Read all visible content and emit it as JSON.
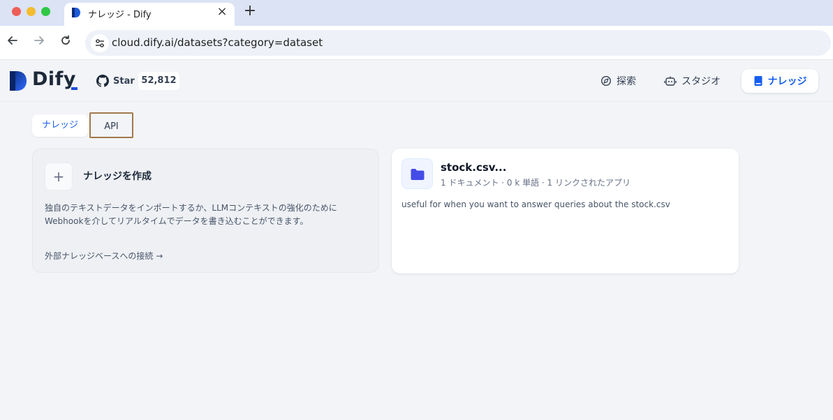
{
  "browser": {
    "tab_title": "ナレッジ - Dify",
    "close_glyph": "×",
    "new_tab_glyph": "+",
    "url": "cloud.dify.ai/datasets?category=dataset"
  },
  "header": {
    "logo_text": "Dify",
    "github_label": "Star",
    "github_stars": "52,812",
    "nav": {
      "explore": "探索",
      "studio": "スタジオ",
      "knowledge": "ナレッジ"
    }
  },
  "tabs": {
    "knowledge": "ナレッジ",
    "api": "API"
  },
  "create_card": {
    "title": "ナレッジを作成",
    "description": "独自のテキストデータをインポートするか、LLMコンテキストの強化のためにWebhookを介してリアルタイムでデータを書き込むことができます。",
    "external_link": "外部ナレッジベースへの接続 →"
  },
  "dataset": {
    "name": "stock.csv...",
    "meta": "1 ドキュメント · 0 k 単語 · 1 リンクされたアプリ",
    "description": "useful for when you want to answer queries about the stock.csv"
  },
  "colors": {
    "accent": "#155eef",
    "background": "#f2f4f7",
    "highlight_border": "#a3784a"
  },
  "icons": {
    "explore": "compass-icon",
    "studio": "robot-icon",
    "knowledge": "book-icon",
    "dataset": "folder-icon"
  }
}
